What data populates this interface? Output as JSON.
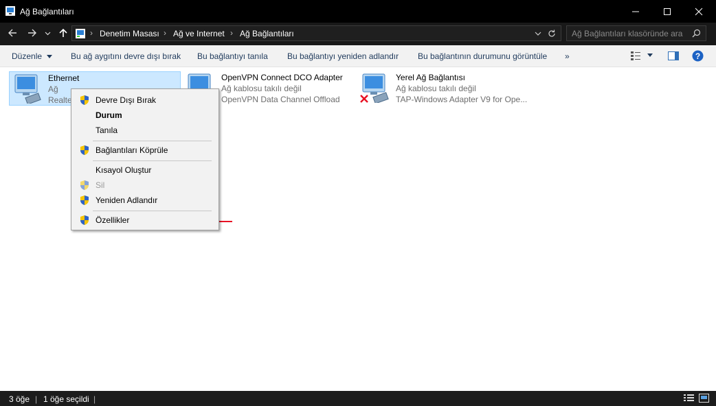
{
  "window": {
    "title": "Ağ Bağlantıları",
    "minimize_icon": "minimize-icon",
    "maximize_icon": "maximize-icon",
    "close_icon": "close-icon"
  },
  "address": {
    "breadcrumbs": [
      "Denetim Masası",
      "Ağ ve Internet",
      "Ağ Bağlantıları"
    ],
    "separator": "›",
    "search_placeholder": "Ağ Bağlantıları klasöründe ara"
  },
  "command_bar": {
    "organize": "Düzenle",
    "items": [
      "Bu ağ aygıtını devre dışı bırak",
      "Bu bağlantıyı tanıla",
      "Bu bağlantıyı yeniden adlandır",
      "Bu bağlantının durumunu görüntüle"
    ],
    "more": "»",
    "help": "?"
  },
  "connections": [
    {
      "name": "Ethernet",
      "status": "Ağ",
      "adapter": "Realte",
      "selected": true
    },
    {
      "name": "OpenVPN Connect DCO Adapter",
      "status": "Ağ kablosu takılı değil",
      "adapter": "OpenVPN Data Channel Offload",
      "selected": false
    },
    {
      "name": "Yerel Ağ Bağlantısı",
      "status": "Ağ kablosu takılı değil",
      "adapter": "TAP-Windows Adapter V9 for Ope...",
      "selected": false
    }
  ],
  "context_menu": {
    "disable": "Devre Dışı Bırak",
    "status": "Durum",
    "diagnose": "Tanıla",
    "bridge": "Bağlantıları Köprüle",
    "shortcut": "Kısayol Oluştur",
    "delete": "Sil",
    "rename": "Yeniden Adlandır",
    "properties": "Özellikler"
  },
  "status_bar": {
    "count": "3 öğe",
    "selected": "1 öğe seçildi"
  },
  "colors": {
    "titlebar": "#000000",
    "selection": "#cce8ff",
    "arrow": "#e81123",
    "link_text": "#1e395b"
  }
}
